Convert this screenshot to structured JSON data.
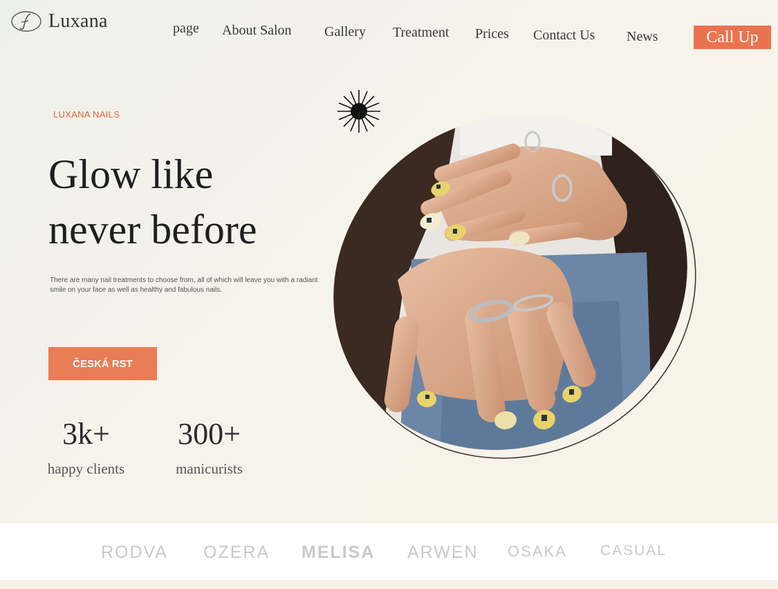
{
  "brand": {
    "name": "Luxana"
  },
  "nav": {
    "items": [
      "page",
      "About Salon",
      "Gallery",
      "Treatment",
      "Prices",
      "Contact Us",
      "News"
    ],
    "call_label": "Call Up"
  },
  "hero": {
    "eyebrow": "LUXANA NAILS",
    "headline_line1": "Glow like",
    "headline_line2": "never before",
    "description": "There are many nail treatments to choose from, all of which will leave you with a radiant smile on your face as well as healthy and fabulous nails.",
    "cta_label": "ČESKÁ RST"
  },
  "stats": [
    {
      "value": "3k+",
      "label": "happy clients"
    },
    {
      "value": "300+",
      "label": "manicurists"
    }
  ],
  "partners": [
    "RODVA",
    "OZERA",
    "MELISA",
    "ARWEN",
    "OSAKA",
    "CASUAL"
  ],
  "colors": {
    "accent": "#e9734e",
    "nail_polish": "#e8d36a",
    "jacket": "#3b2a22",
    "jeans": "#5a7a9e",
    "skin": "#d6a88a"
  }
}
